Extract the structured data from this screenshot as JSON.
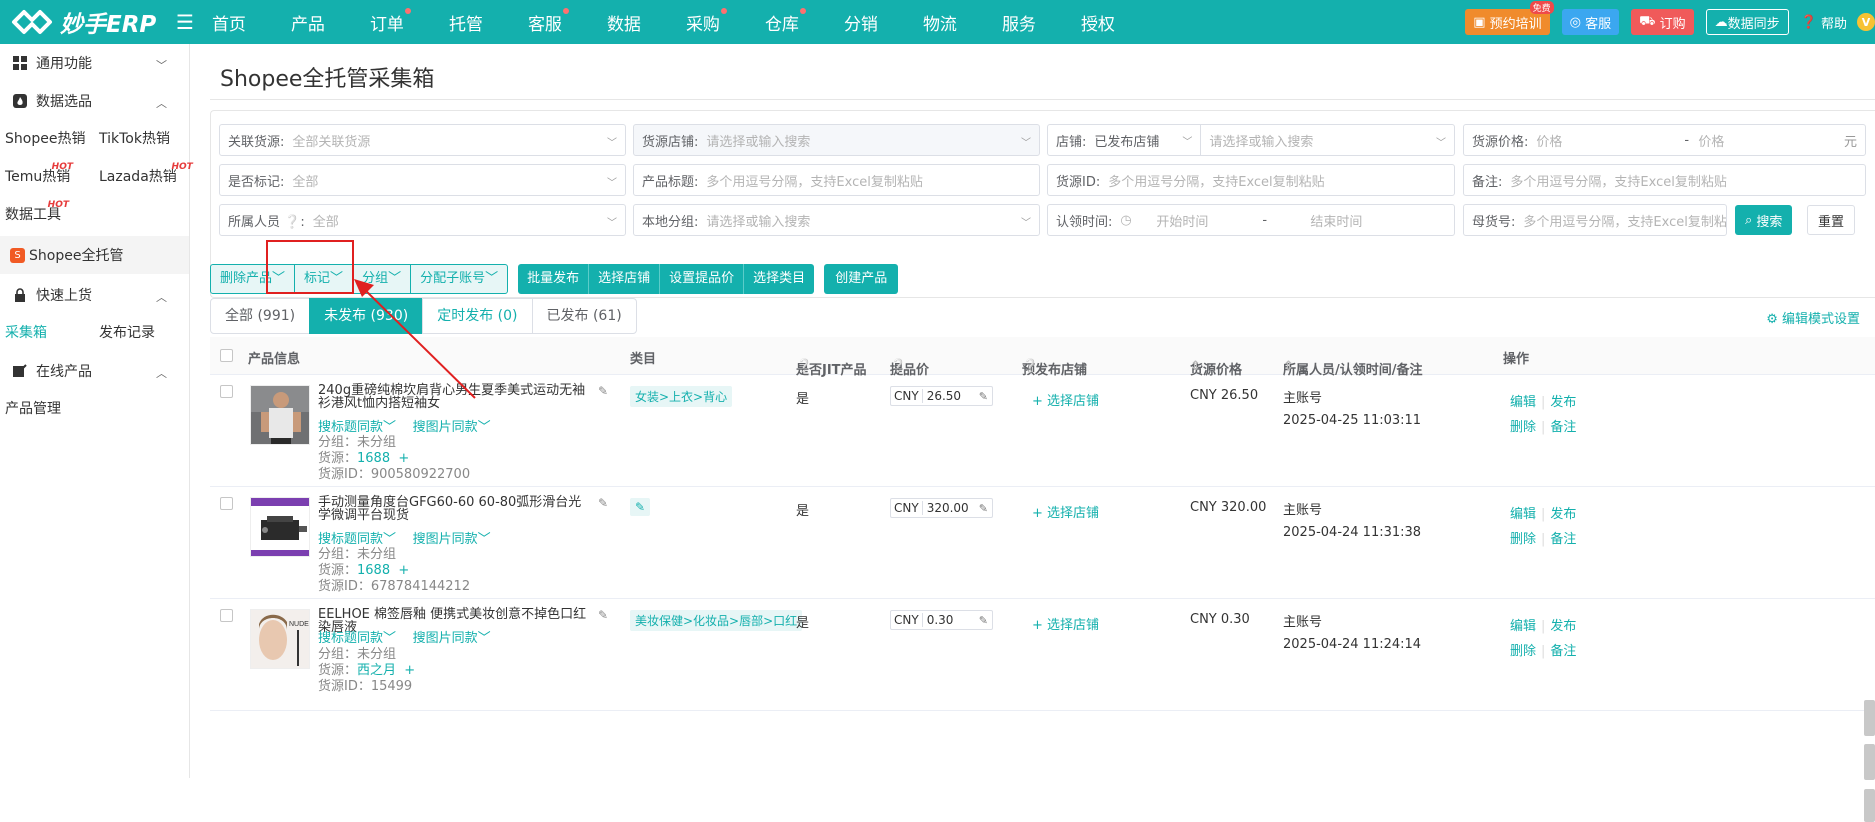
{
  "app": {
    "name": "妙手ERP"
  },
  "nav": [
    "首页",
    "产品",
    "订单",
    "托管",
    "客服",
    "数据",
    "采购",
    "仓库",
    "分销",
    "物流",
    "服务",
    "授权"
  ],
  "top_right": {
    "train": "预约培训",
    "free_badge": "免费",
    "kefu": "客服",
    "order": "订购",
    "sync": "数据同步",
    "help": "帮助",
    "vip": "V"
  },
  "sidebar": {
    "general": "通用功能",
    "data_select": "数据选品",
    "shopee_hot": "Shopee热销",
    "tiktok_hot": "TikTok热销",
    "temu_hot": "Temu热销",
    "lazada_hot": "Lazada热销",
    "data_tools": "数据工具",
    "hot_badge": "HOT",
    "shopee_full": "Shopee全托管",
    "quick_upload": "快速上货",
    "collect_box": "采集箱",
    "publish_records": "发布记录",
    "online_products": "在线产品",
    "product_mgmt": "产品管理"
  },
  "page": {
    "title": "Shopee全托管采集箱"
  },
  "filters": {
    "related_source": {
      "label": "关联货源:",
      "placeholder": "全部关联货源"
    },
    "source_store": {
      "label": "货源店铺:",
      "placeholder": "请选择或输入搜索"
    },
    "store": {
      "label": "店铺:",
      "value": "已发布店铺",
      "placeholder": "请选择或输入搜索"
    },
    "source_price": {
      "label": "货源价格:",
      "ph_min": "价格",
      "dash": "-",
      "ph_max": "价格",
      "unit": "元"
    },
    "marked": {
      "label": "是否标记:",
      "value": "全部"
    },
    "product_title": {
      "label": "产品标题:",
      "placeholder": "多个用逗号分隔，支持Excel复制粘贴"
    },
    "source_id": {
      "label": "货源ID:",
      "placeholder": "多个用逗号分隔，支持Excel复制粘贴"
    },
    "remark": {
      "label": "备注:",
      "placeholder": "多个用逗号分隔，支持Excel复制粘贴"
    },
    "owner": {
      "label": "所属人员",
      "value": "全部"
    },
    "local_group": {
      "label": "本地分组:",
      "placeholder": "请选择或输入搜索"
    },
    "claim_time": {
      "label": "认领时间:",
      "start": "开始时间",
      "dash": "-",
      "end": "结束时间"
    },
    "parent_sku": {
      "label": "母货号:",
      "placeholder": "多个用逗号分隔，支持Excel复制粘贴"
    },
    "search_btn": "搜索",
    "reset_btn": "重置"
  },
  "actions": {
    "delete": "删除产品",
    "mark": "标记",
    "group": "分组",
    "assign": "分配子账号",
    "batch_publish": "批量发布",
    "select_store": "选择店铺",
    "set_price": "设置提品价",
    "select_category": "选择类目",
    "create": "创建产品"
  },
  "tabs": [
    {
      "label": "全部 (991)"
    },
    {
      "label": "未发布 (930)"
    },
    {
      "label": "定时发布 (0)"
    },
    {
      "label": "已发布 (61)"
    }
  ],
  "edit_mode": "编辑模式设置",
  "columns": {
    "product_info": "产品信息",
    "category": "类目",
    "jit": "是否JIT产品",
    "submit_price": "提品价",
    "pre_store": "预发布店铺",
    "source_price": "货源价格",
    "owner": "所属人员/认领时间/备注",
    "ops": "操作"
  },
  "row_common": {
    "search_title_same": "搜标题同款",
    "search_image_same": "搜图片同款",
    "select_store": "+ 选择店铺",
    "currency": "CNY",
    "edit": "编辑",
    "publish": "发布",
    "delete": "删除",
    "remark": "备注",
    "plus": "+"
  },
  "rows": [
    {
      "title": "240g重磅纯棉坎肩背心男生夏季美式运动无袖衫港风t恤内搭短袖女",
      "category": "女装>上衣>背心",
      "group": "分组：未分组",
      "source_label": "货源：",
      "source": "1688",
      "source_id": "货源ID：900580922700",
      "jit": "是",
      "price": "26.50",
      "source_price": "CNY 26.50",
      "owner": "主账号",
      "time": "2025-04-25 11:03:11"
    },
    {
      "title": "手动测量角度台GFG60-60 60-80弧形滑台光学微调平台现货",
      "category": "",
      "group": "分组：未分组",
      "source_label": "货源：",
      "source": "1688",
      "source_id": "货源ID：678784144212",
      "jit": "是",
      "price": "320.00",
      "source_price": "CNY 320.00",
      "owner": "主账号",
      "time": "2025-04-24 11:31:38"
    },
    {
      "title": "EELHOE 棉签唇釉 便携式美妆创意不掉色口红染唇液",
      "category": "美妆保健>化妆品>唇部>口红",
      "group": "分组：未分组",
      "source_label": "货源：",
      "source": "西之月",
      "source_id": "货源ID：15499",
      "jit": "是",
      "price": "0.30",
      "source_price": "CNY 0.30",
      "owner": "主账号",
      "time": "2025-04-24 11:24:14"
    }
  ],
  "images": {
    "nude_label": "NUDE"
  },
  "colors": {
    "primary": "#14b0ad",
    "highlight": "#e02020"
  }
}
